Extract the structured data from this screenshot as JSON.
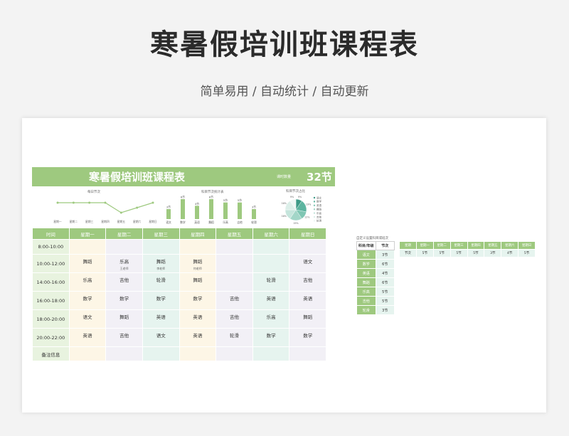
{
  "hero": {
    "title": "寒暑假培训班课程表",
    "subtitle": "简单易用 / 自动统计 / 自动更新"
  },
  "banner": {
    "title": "寒暑假培训班课程表",
    "count_label": "课时数量",
    "count": "32节"
  },
  "line_chart": {
    "title": "每日节次",
    "days": [
      "星期一",
      "星期二",
      "星期三",
      "星期四",
      "星期五",
      "星期六",
      "星期日"
    ],
    "values": [
      5,
      5,
      5,
      5,
      3,
      4,
      5
    ]
  },
  "bar_chart": {
    "title": "科目节次统计表",
    "subjects": [
      "语文",
      "数学",
      "英语",
      "舞蹈",
      "乐高",
      "吉他",
      "轮滑"
    ],
    "values": [
      3,
      6,
      4,
      6,
      5,
      5,
      3
    ],
    "labels": [
      "3节",
      "6节",
      "4节",
      "6节",
      "5节",
      "5节",
      "3节"
    ]
  },
  "pie_chart": {
    "title": "科目节次占比",
    "legend": [
      "语文",
      "数学",
      "英语",
      "舞蹈",
      "乐高",
      "吉他",
      "轮滑"
    ],
    "values": [
      3,
      6,
      4,
      6,
      5,
      5,
      3
    ],
    "colors": [
      "#3d9a86",
      "#5cb49f",
      "#7fc6b3",
      "#a3d6c8",
      "#c5e5dc",
      "#dcefe9",
      "#eef7f4"
    ],
    "slice_labels": [
      "9%",
      "19%",
      "12%",
      "19%",
      "16%",
      "16%",
      "9%"
    ]
  },
  "timetable": {
    "headers": [
      "时间",
      "星期一",
      "星期二",
      "星期三",
      "星期四",
      "星期五",
      "星期六",
      "星期日"
    ],
    "times": [
      "8:00-10:00",
      "10:00-12:00",
      "14:00-16:00",
      "16:00-18:00",
      "18:00-20:00",
      "20:00-22:00",
      "备注信息"
    ],
    "rows": [
      [
        [
          "",
          ""
        ],
        [
          "",
          ""
        ],
        [
          "",
          ""
        ],
        [
          "",
          ""
        ],
        [
          "",
          ""
        ],
        [
          "",
          ""
        ],
        [
          "",
          ""
        ]
      ],
      [
        [
          "舞蹈",
          ""
        ],
        [
          "乐高",
          "王老师"
        ],
        [
          "舞蹈",
          "李老师"
        ],
        [
          "舞蹈",
          "何老师"
        ],
        [
          "",
          ""
        ],
        [
          "",
          ""
        ],
        [
          "语文",
          ""
        ]
      ],
      [
        [
          "乐高",
          ""
        ],
        [
          "吉他",
          ""
        ],
        [
          "轮滑",
          ""
        ],
        [
          "舞蹈",
          ""
        ],
        [
          "",
          ""
        ],
        [
          "轮滑",
          ""
        ],
        [
          "吉他",
          ""
        ]
      ],
      [
        [
          "数学",
          ""
        ],
        [
          "数学",
          ""
        ],
        [
          "数学",
          ""
        ],
        [
          "数学",
          ""
        ],
        [
          "吉他",
          ""
        ],
        [
          "英语",
          ""
        ],
        [
          "英语",
          ""
        ]
      ],
      [
        [
          "语文",
          ""
        ],
        [
          "舞蹈",
          ""
        ],
        [
          "英语",
          ""
        ],
        [
          "英语",
          ""
        ],
        [
          "吉他",
          ""
        ],
        [
          "乐高",
          ""
        ],
        [
          "舞蹈",
          ""
        ]
      ],
      [
        [
          "英语",
          ""
        ],
        [
          "吉他",
          ""
        ],
        [
          "语文",
          ""
        ],
        [
          "英语",
          ""
        ],
        [
          "轮滑",
          ""
        ],
        [
          "数学",
          ""
        ],
        [
          "数学",
          ""
        ]
      ],
      [
        [
          "",
          ""
        ],
        [
          "",
          ""
        ],
        [
          "",
          ""
        ],
        [
          "",
          ""
        ],
        [
          "",
          ""
        ],
        [
          "",
          ""
        ],
        [
          "",
          ""
        ]
      ]
    ]
  },
  "side_table": {
    "caption": "自定义设置科目或班次",
    "headers": [
      "科目/年级",
      "节次"
    ],
    "rows": [
      [
        "语文",
        "3节"
      ],
      [
        "数学",
        "6节"
      ],
      [
        "英语",
        "4节"
      ],
      [
        "舞蹈",
        "6节"
      ],
      [
        "乐高",
        "5节"
      ],
      [
        "吉他",
        "5节"
      ],
      [
        "轮滑",
        "3节"
      ]
    ]
  },
  "week_table": {
    "headers": [
      "星期",
      "星期一",
      "星期二",
      "星期三",
      "星期四",
      "星期五",
      "星期六",
      "星期日"
    ],
    "row": [
      "节次",
      "5节",
      "5节",
      "5节",
      "5节",
      "3节",
      "4节",
      "5节"
    ]
  }
}
